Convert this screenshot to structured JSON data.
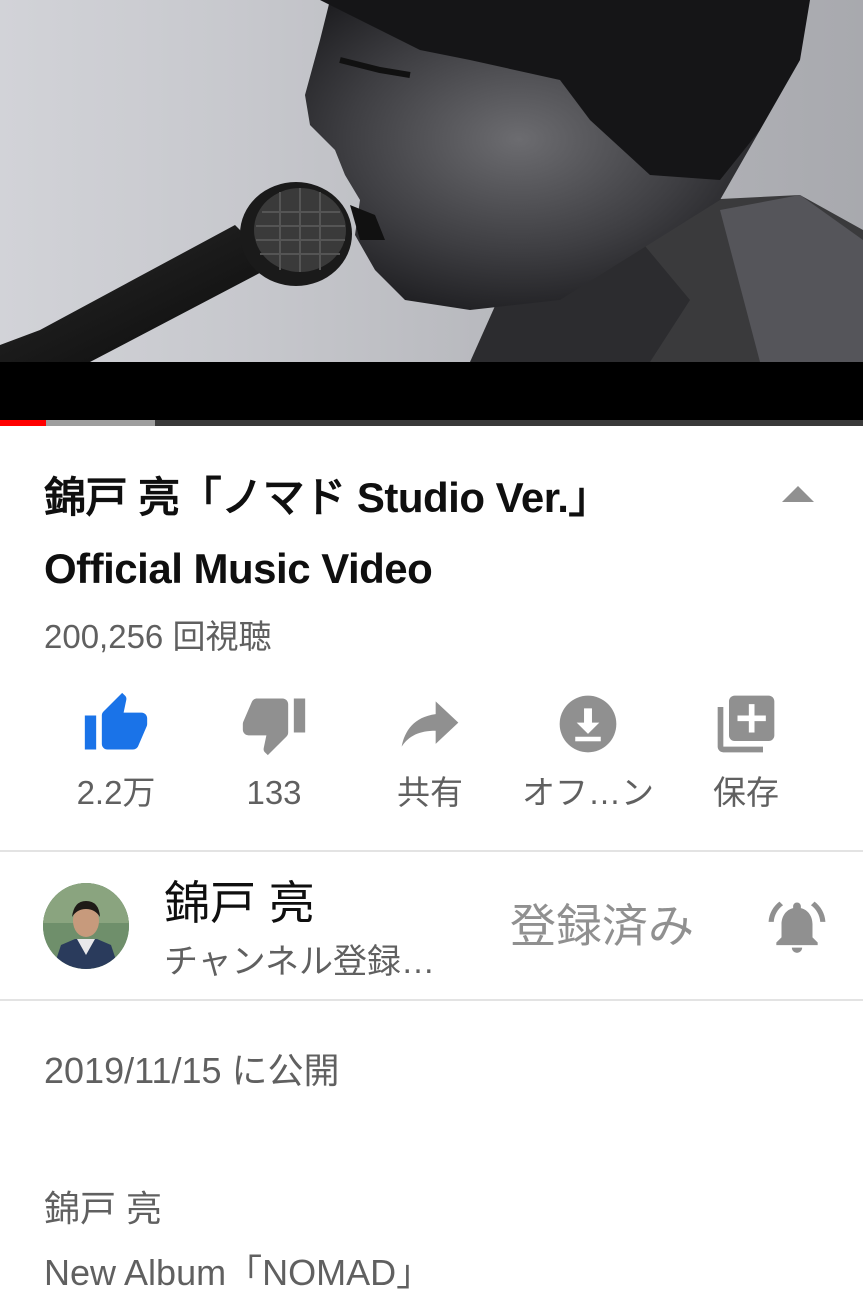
{
  "video": {
    "progress_played": 0.053,
    "progress_buffered": 0.18
  },
  "title": "錦戸 亮「ノマド Studio Ver.」Official Music Video",
  "title_line1": "錦戸 亮「ノマド Studio Ver.」",
  "title_line2": "Official Music Video",
  "view_count": "200,256 回視聴",
  "actions": [
    {
      "icon": "thumbs-up-icon",
      "label": "2.2万",
      "active": true
    },
    {
      "icon": "thumbs-down-icon",
      "label": "133"
    },
    {
      "icon": "share-icon",
      "label": "共有"
    },
    {
      "icon": "download-icon",
      "label": "オフ…ン"
    },
    {
      "icon": "add-to-playlist-icon",
      "label": "保存"
    }
  ],
  "channel": {
    "name": "錦戸 亮",
    "subscribers": "チャンネル登録…",
    "subscribe_label": "登録済み"
  },
  "description": {
    "published": "2019/11/15 に公開",
    "lines": [
      "錦戸 亮",
      "New Album「NOMAD」"
    ]
  },
  "colors": {
    "accent_blue": "#1a73e8",
    "progress_red": "#ff0000",
    "icon_gray": "#909090"
  }
}
